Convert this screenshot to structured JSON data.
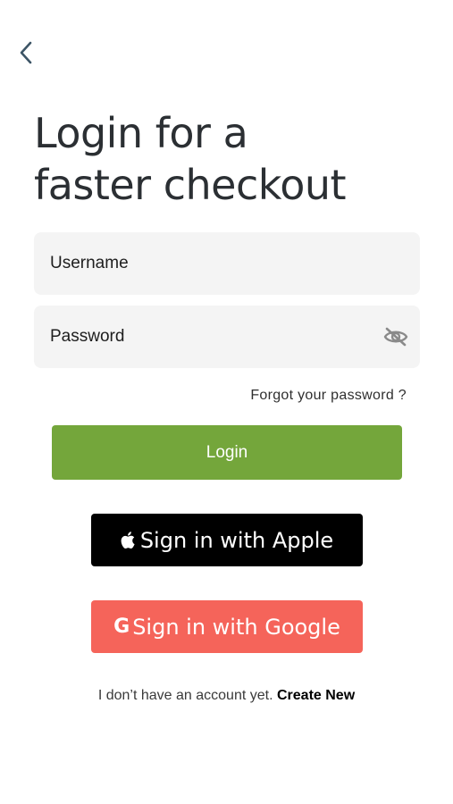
{
  "header": {
    "back_icon": "chevron-left-icon"
  },
  "title": {
    "line1": "Login for a",
    "line2": "faster checkout"
  },
  "form": {
    "username_placeholder": "Username",
    "password_placeholder": "Password",
    "password_visibility_icon": "eye-off-icon",
    "forgot_label": "Forgot your password ?",
    "login_label": "Login"
  },
  "social": {
    "apple_icon": "apple-icon",
    "apple_label": "Sign in with Apple",
    "google_icon_text": "G",
    "google_label": "Sign in with Google"
  },
  "footer": {
    "no_account_text": "I don’t have an account yet.",
    "create_label": "Create New"
  },
  "colors": {
    "primary": "#74a63b",
    "apple": "#000000",
    "google": "#f5645a",
    "field_bg": "#f4f4f4"
  }
}
